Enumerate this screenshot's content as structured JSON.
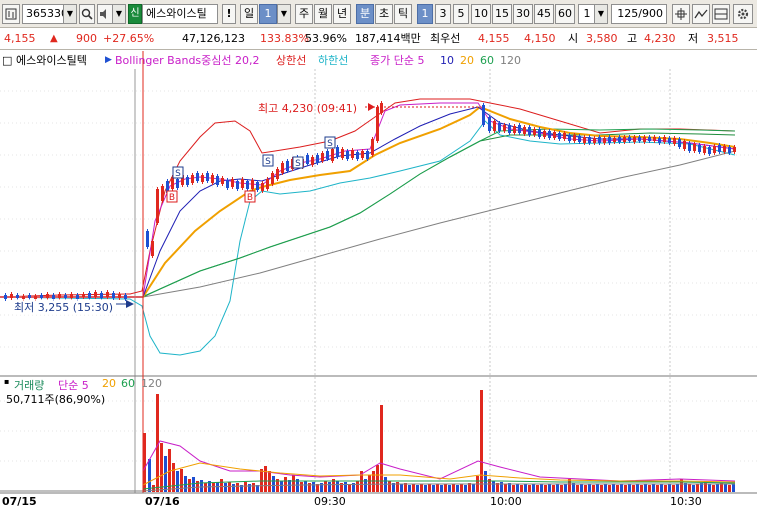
{
  "toolbar": {
    "code": "365330",
    "market_badge": "신",
    "stock_name": "에스와이스틸",
    "alert_label": "!",
    "period_day": "일",
    "period_count": "1",
    "period_week": "주",
    "period_month": "월",
    "period_year": "년",
    "period_minute": "분",
    "period_tick": "초",
    "period_tic2": "틱",
    "intervals": [
      "1",
      "3",
      "5",
      "10",
      "15",
      "30",
      "45",
      "60"
    ],
    "selected_interval": "1",
    "custom_interval": "1",
    "bars_display": "125/900"
  },
  "quote": {
    "price": "4,155",
    "change": "900",
    "change_pct": "+27.65%",
    "volume": "47,126,123",
    "volume_ratio": "133.83%",
    "turnover_pct": "53.96%",
    "trade_value": "187,414백만",
    "priority_label": "최우선",
    "ask": "4,155",
    "bid": "4,150",
    "open_label": "시",
    "open": "3,580",
    "high_label": "고",
    "high": "4,230",
    "low_label": "저",
    "low": "3,515"
  },
  "legend": {
    "name": "에스와이스틸텍",
    "bollinger": "Bollinger Bands중심선 20,2",
    "upper": "상한선",
    "lower": "하한선",
    "ma_label": "종가 단순 5",
    "ma_periods": [
      "10",
      "20",
      "60",
      "120"
    ]
  },
  "annotations": {
    "high": "최고 4,230 (09:41)",
    "low": "최저 3,255 (15:30)",
    "markers": [
      "S",
      "S",
      "S",
      "S",
      "B",
      "B"
    ]
  },
  "volume_legend": {
    "name": "거래량",
    "ma_label": "단순 5",
    "periods": [
      "20",
      "60",
      "120"
    ],
    "value": "50,711주(86,90%)"
  },
  "time_axis": [
    "07/15",
    "07/16",
    "09:30",
    "10:00",
    "10:30"
  ],
  "colors": {
    "up": "#e0281e",
    "down": "#1e50d2",
    "ma5": "#c81ec8",
    "ma10": "#1e1eb4",
    "ma20": "#f0a000",
    "ma60": "#1ea050",
    "ma120": "#808080",
    "bb_upper": "#dc1e1e",
    "bb_lower": "#1eb4c8",
    "bb_mid": "#1e8c3c"
  }
}
